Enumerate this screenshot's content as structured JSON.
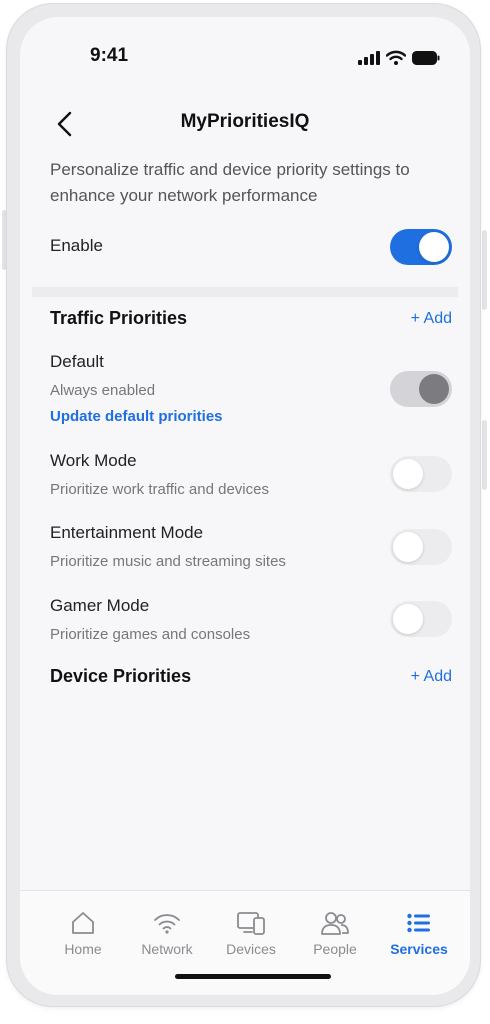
{
  "status_bar": {
    "time": "9:41"
  },
  "header": {
    "title": "MyPrioritiesIQ"
  },
  "intro": {
    "description": "Personalize traffic and device priority settings to enhance your network performance",
    "enable_label": "Enable",
    "enable_on": true
  },
  "traffic": {
    "title": "Traffic Priorities",
    "add_label": "+ Add",
    "items": [
      {
        "title": "Default",
        "subtitle": "Always enabled",
        "link": "Update default priorities",
        "state": "locked"
      },
      {
        "title": "Work Mode",
        "subtitle": "Prioritize work traffic and devices",
        "state": "off"
      },
      {
        "title": "Entertainment Mode",
        "subtitle": "Prioritize music and streaming sites",
        "state": "off"
      },
      {
        "title": "Gamer Mode",
        "subtitle": "Prioritize games and consoles",
        "state": "off"
      }
    ]
  },
  "devices": {
    "title": "Device Priorities",
    "add_label": "+ Add"
  },
  "tabbar": {
    "tabs": [
      {
        "label": "Home",
        "icon": "home-icon"
      },
      {
        "label": "Network",
        "icon": "wifi-icon"
      },
      {
        "label": "Devices",
        "icon": "devices-icon"
      },
      {
        "label": "People",
        "icon": "people-icon"
      },
      {
        "label": "Services",
        "icon": "list-icon",
        "active": true
      }
    ]
  },
  "colors": {
    "accent": "#1f6fe0",
    "toggle_off": "#ececee",
    "toggle_locked": "#d4d4d8"
  }
}
